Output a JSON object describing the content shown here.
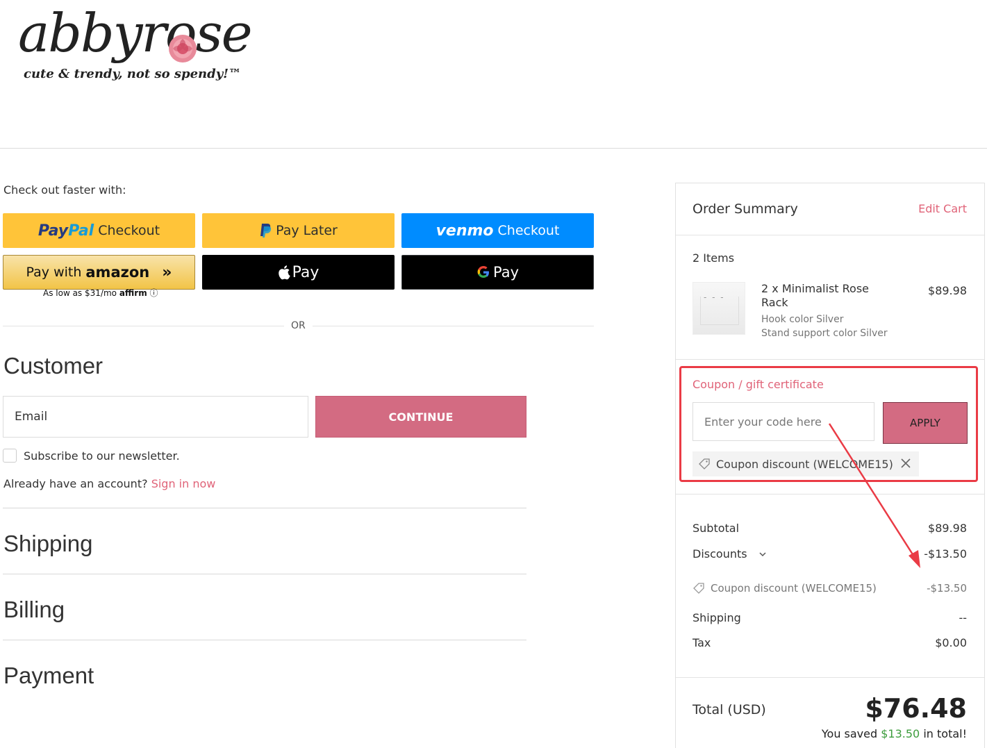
{
  "brand": {
    "name": "abbyrose",
    "tagline": "cute & trendy, not so spendy!™"
  },
  "express": {
    "heading": "Check out faster with:",
    "paypal": {
      "logo_a": "Pay",
      "logo_b": "Pal",
      "label": "Checkout"
    },
    "paylater": {
      "label": "Pay Later"
    },
    "venmo": {
      "logo": "venmo",
      "label": "Checkout"
    },
    "amazon": {
      "label": "Pay with",
      "logo": "amazon"
    },
    "applepay": {
      "label": "Pay"
    },
    "gpay": {
      "label": "Pay"
    },
    "affirm_text": "As low as $31/mo",
    "affirm_logo": "affirm",
    "or_label": "OR"
  },
  "customer": {
    "title": "Customer",
    "email_label": "Email",
    "continue_label": "CONTINUE",
    "newsletter_label": "Subscribe to our newsletter.",
    "account_prompt": "Already have an account?",
    "signin_label": "Sign in now"
  },
  "steps": {
    "shipping": "Shipping",
    "billing": "Billing",
    "payment": "Payment"
  },
  "summary": {
    "title": "Order Summary",
    "edit_cart": "Edit Cart",
    "items_count": "2 Items",
    "product": {
      "name": "2 x Minimalist Rose Rack",
      "price": "$89.98",
      "option1": "Hook color Silver",
      "option2": "Stand support color Silver"
    },
    "coupon": {
      "title": "Coupon / gift certificate",
      "placeholder": "Enter your code here",
      "apply_label": "APPLY",
      "applied_label": "Coupon discount (WELCOME15)"
    },
    "subtotal_label": "Subtotal",
    "subtotal_value": "$89.98",
    "discounts_label": "Discounts",
    "discounts_value": "-$13.50",
    "discount_detail_label": "Coupon discount (WELCOME15)",
    "discount_detail_value": "-$13.50",
    "shipping_label": "Shipping",
    "shipping_value": "--",
    "tax_label": "Tax",
    "tax_value": "$0.00",
    "total_label": "Total (USD)",
    "total_value": "$76.48",
    "saved_prefix": "You saved",
    "saved_amount": "$13.50",
    "saved_suffix": "in total!"
  },
  "colors": {
    "accent_pink": "#d36b82",
    "link_pink": "#e06378",
    "annotation_red": "#ea3b45",
    "paypal_yellow": "#ffc439",
    "venmo_blue": "#008cff",
    "savings_green": "#3d9c3d"
  }
}
